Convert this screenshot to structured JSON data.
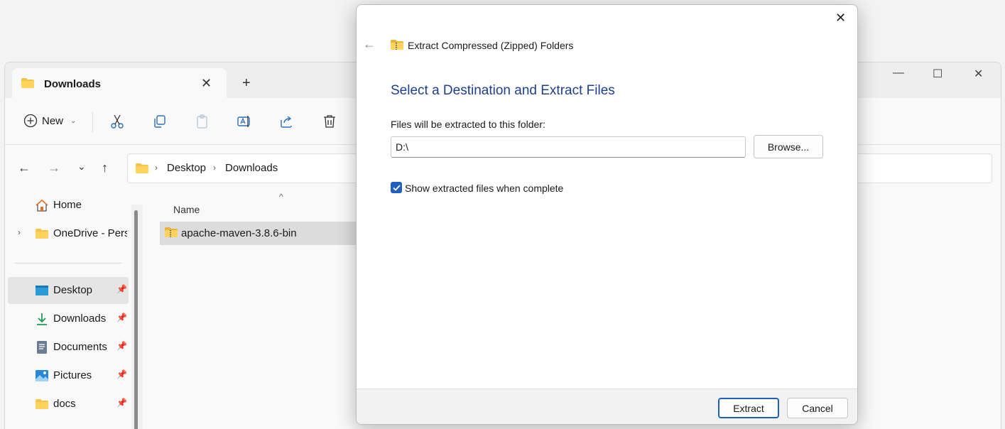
{
  "explorer": {
    "tab_title": "Downloads",
    "new_label": "New",
    "breadcrumb": [
      "Desktop",
      "Downloads"
    ],
    "column_name": "Name",
    "files": [
      {
        "name": "apache-maven-3.8.6-bin",
        "icon": "zip-folder-icon"
      }
    ],
    "sidebar": {
      "top": [
        {
          "label": "Home",
          "icon": "home-icon"
        },
        {
          "label": "OneDrive - Perso",
          "icon": "folder-icon"
        }
      ],
      "pinned": [
        {
          "label": "Desktop",
          "icon": "desktop-icon",
          "selected": true
        },
        {
          "label": "Downloads",
          "icon": "download-icon"
        },
        {
          "label": "Documents",
          "icon": "document-icon"
        },
        {
          "label": "Pictures",
          "icon": "pictures-icon"
        },
        {
          "label": "docs",
          "icon": "folder-icon"
        }
      ]
    }
  },
  "dialog": {
    "title": "Extract Compressed (Zipped) Folders",
    "heading": "Select a Destination and Extract Files",
    "dest_label": "Files will be extracted to this folder:",
    "dest_value": "D:\\",
    "browse_label": "Browse...",
    "show_files_label": "Show extracted files when complete",
    "show_files_checked": true,
    "extract_label": "Extract",
    "cancel_label": "Cancel"
  },
  "colors": {
    "accent": "#1f5fbf",
    "heading": "#1e3f8a",
    "folder": "#f6c344"
  }
}
